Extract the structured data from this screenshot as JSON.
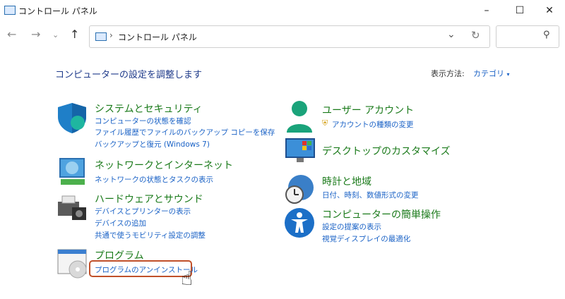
{
  "window": {
    "title": "コントロール パネル"
  },
  "address": {
    "path": "コントロール パネル"
  },
  "main": {
    "heading": "コンピューターの設定を調整します",
    "view_by_label": "表示方法:",
    "view_by_value": "カテゴリ"
  },
  "categories": [
    {
      "title": "システムとセキュリティ",
      "links": [
        "コンピューターの状態を確認",
        "ファイル履歴でファイルのバックアップ コピーを保存",
        "バックアップと復元 (Windows 7)"
      ]
    },
    {
      "title": "ネットワークとインターネット",
      "links": [
        "ネットワークの状態とタスクの表示"
      ]
    },
    {
      "title": "ハードウェアとサウンド",
      "links": [
        "デバイスとプリンターの表示",
        "デバイスの追加",
        "共通で使うモビリティ設定の調整"
      ]
    },
    {
      "title": "プログラム",
      "links": [
        "プログラムのアンインストール"
      ]
    },
    {
      "title": "ユーザー アカウント",
      "links": [
        "アカウントの種類の変更"
      ]
    },
    {
      "title": "デスクトップのカスタマイズ",
      "links": []
    },
    {
      "title": "時計と地域",
      "links": [
        "日付、時刻、数値形式の変更"
      ]
    },
    {
      "title": "コンピューターの簡単操作",
      "links": [
        "設定の提案の表示",
        "視覚ディスプレイの最適化"
      ]
    }
  ],
  "colors": {
    "category_title": "#1a7a1a",
    "link": "#1a62c6",
    "highlight": "#c0502a"
  }
}
